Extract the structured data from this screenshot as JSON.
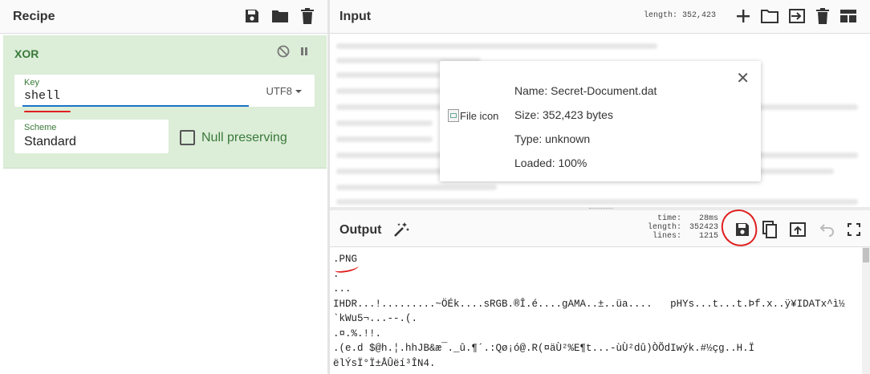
{
  "recipe": {
    "title": "Recipe",
    "header_icons": [
      "save-icon",
      "folder-icon",
      "trash-icon"
    ],
    "operation": {
      "name": "XOR",
      "controls": [
        "disable-icon",
        "pause-icon"
      ],
      "key": {
        "label": "Key",
        "value": "shell",
        "encoding": "UTF8"
      },
      "scheme": {
        "label": "Scheme",
        "value": "Standard"
      },
      "null_preserving": {
        "label": "Null preserving",
        "checked": false
      }
    }
  },
  "input": {
    "title": "Input",
    "length_label": "length:",
    "length_value": "352,423",
    "header_icons": [
      "plus-icon",
      "folder-icon",
      "import-icon",
      "trash-icon",
      "layout-icon"
    ],
    "file": {
      "icon_alt": "File icon",
      "name": "Name: Secret-Document.dat",
      "size": "Size: 352,423 bytes",
      "type": "Type: unknown",
      "loaded": "Loaded: 100%"
    }
  },
  "output": {
    "title": "Output",
    "stats": {
      "time_label": "time:",
      "time_value": "28ms",
      "length_label": "length:",
      "length_value": "352423",
      "lines_label": "lines:",
      "lines_value": "1215"
    },
    "header_icons": [
      "save-icon",
      "copy-icon",
      "replace-input-icon",
      "undo-icon",
      "maximize-icon"
    ],
    "lines": [
      ".PNG",
      ".",
      "...",
      "IHDR...!.........~ÖÉk....sRGB.®Î.é....gAMA..±..üa....   pHYs...t...t.Þf.x..ÿ¥IDATx^ì½",
      "`kWu5¬...--.(.",
      ".¤.%.!!.",
      ".(e.d $@h.¦.hhJB&æ¯._û.¶´.:Qø¡ó@.R(¤äÙ²%E¶t...-ùÙ²dû)ÒÕdIwýk.#½çg..H.Ï",
      "ëlÝsÏ°Ï±ÅÛëí³ÎN4."
    ]
  },
  "colors": {
    "op_background": "#dcedd8",
    "op_text": "#3a7a3a",
    "annotation": "#e02020",
    "focus": "#1a73c8"
  }
}
